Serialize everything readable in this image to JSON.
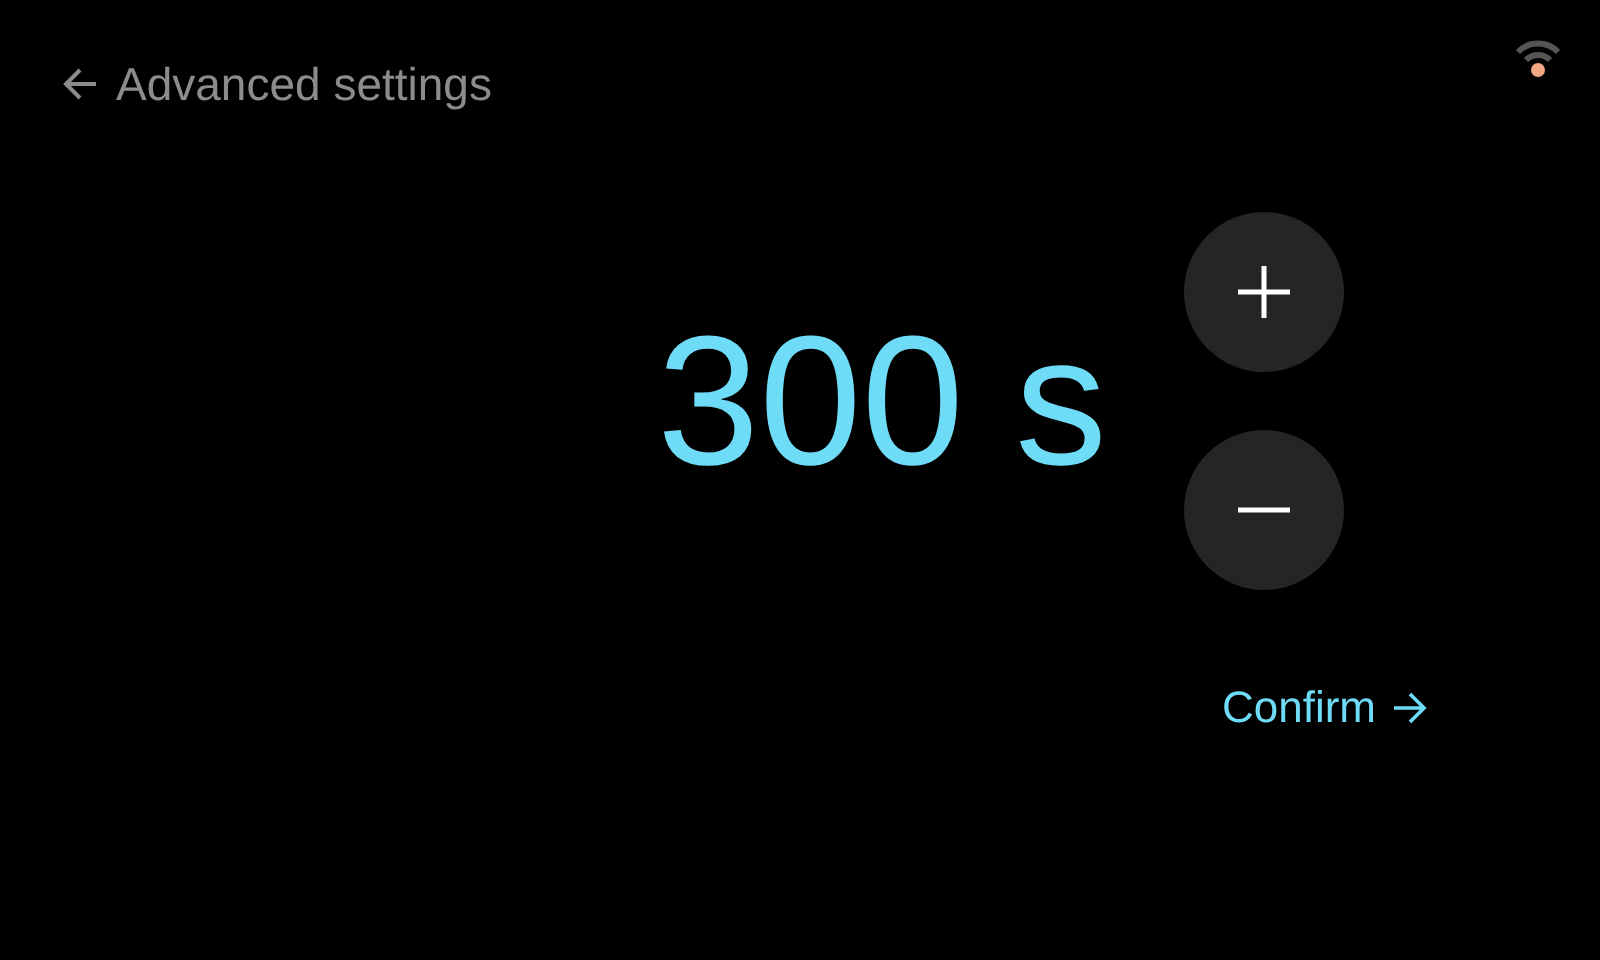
{
  "header": {
    "title": "Advanced settings"
  },
  "value": {
    "reading": "300 s"
  },
  "confirm": {
    "label": "Confirm"
  }
}
